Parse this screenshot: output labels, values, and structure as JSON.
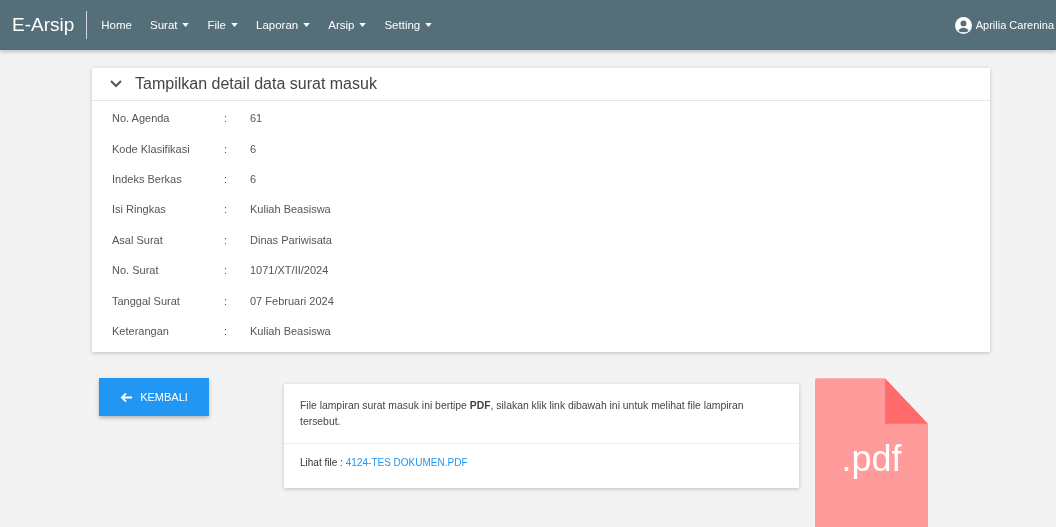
{
  "navbar": {
    "brand": "E-Arsip",
    "menu": [
      {
        "label": "Home",
        "dropdown": false
      },
      {
        "label": "Surat",
        "dropdown": true
      },
      {
        "label": "File",
        "dropdown": true
      },
      {
        "label": "Laporan",
        "dropdown": true
      },
      {
        "label": "Arsip",
        "dropdown": true
      },
      {
        "label": "Setting",
        "dropdown": true
      }
    ],
    "user": "Aprilia Carenina"
  },
  "detail": {
    "title": "Tampilkan detail data surat masuk",
    "expanded": true,
    "separator": ":",
    "rows": [
      {
        "label": "No. Agenda",
        "value": "61"
      },
      {
        "label": "Kode Klasifikasi",
        "value": "6"
      },
      {
        "label": "Indeks Berkas",
        "value": "6"
      },
      {
        "label": "Isi Ringkas",
        "value": "Kuliah Beasiswa"
      },
      {
        "label": "Asal Surat",
        "value": "Dinas Pariwisata"
      },
      {
        "label": "No. Surat",
        "value": "1071/XT/II/2024"
      },
      {
        "label": "Tanggal Surat",
        "value": "07 Februari 2024"
      },
      {
        "label": "Keterangan",
        "value": "Kuliah Beasiswa"
      }
    ]
  },
  "back_button": "KEMBALI",
  "attachment": {
    "message": "File lampiran surat masuk ini bertipe **PDF**, silakan klik link dibawah ini untuk melihat file lampiran tersebut.",
    "link_label": "Lihat file :",
    "link": "4124-TES DOKUMEN.PDF",
    "file_icon_text": ".pdf"
  }
}
